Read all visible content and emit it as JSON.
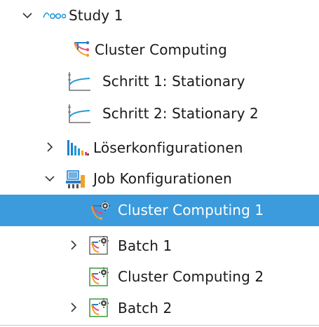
{
  "tree": {
    "items": [
      {
        "label": "Study 1",
        "icon": "study-icon",
        "expander": "expanded"
      },
      {
        "label": "Cluster Computing",
        "icon": "cluster-computing-icon",
        "expander": "none"
      },
      {
        "label": "Schritt 1: Stationary",
        "icon": "stationary-step-icon",
        "expander": "none"
      },
      {
        "label": "Schritt 2: Stationary 2",
        "icon": "stationary-step-icon",
        "expander": "none"
      },
      {
        "label": "Löserkonfigurationen",
        "icon": "solver-configurations-icon",
        "expander": "collapsed"
      },
      {
        "label": "Job Konfigurationen",
        "icon": "job-configurations-icon",
        "expander": "expanded"
      },
      {
        "label": "Cluster Computing 1",
        "icon": "cluster-job-icon",
        "expander": "none",
        "selected": true
      },
      {
        "label": "Batch 1",
        "icon": "batch-icon",
        "expander": "collapsed"
      },
      {
        "label": "Cluster Computing 2",
        "icon": "cluster-job-icon",
        "expander": "none"
      },
      {
        "label": "Batch 2",
        "icon": "batch-icon",
        "expander": "collapsed"
      }
    ]
  },
  "colors": {
    "selection": "#3b9bdc",
    "text": "#1a1a1a",
    "selected_text": "#ffffff"
  }
}
